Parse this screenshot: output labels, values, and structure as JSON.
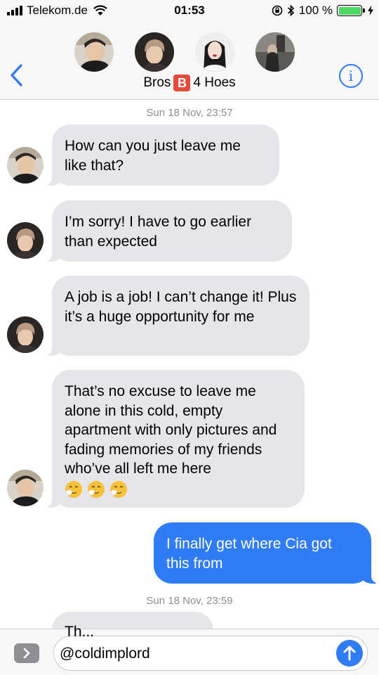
{
  "status_bar": {
    "carrier": "Telekom.de",
    "time": "01:53",
    "battery_percent": "100 %",
    "battery_level": 1.0,
    "icons": [
      "signal-icon",
      "wifi-icon",
      "rotation-lock-icon",
      "bluetooth-icon",
      "battery-icon",
      "charging-icon"
    ]
  },
  "header": {
    "group_name_prefix": "Bros",
    "group_badge": "B",
    "group_name_suffix": "4 Hoes",
    "back_icon": "chevron-left-icon",
    "info_icon": "info-icon",
    "info_glyph": "i",
    "accent_color": "#2f7cf6"
  },
  "conversation": {
    "timestamp_1": "Sun 18 Nov, 23:57",
    "messages": [
      {
        "direction": "incoming",
        "text": "How can you just leave me like that?"
      },
      {
        "direction": "incoming",
        "text": "I’m sorry! I have to go earlier than expected"
      },
      {
        "direction": "incoming",
        "text": "A job is a job! I can’t change it! Plus it’s a huge opportunity for me"
      },
      {
        "direction": "incoming",
        "text": "That’s no excuse to leave me alone in this  cold, empty apartment with only pictures and fading memories of my friends who’ve all left me here",
        "emoji": [
          "sneezing-face-emoji",
          "sneezing-face-emoji",
          "sneezing-face-emoji"
        ]
      },
      {
        "direction": "outgoing",
        "text": "I finally get where Cia got this from"
      }
    ],
    "timestamp_2": "Sun 18 Nov, 23:59",
    "partial_message": "Th...",
    "incoming_color": "#e5e5ea",
    "outgoing_color": "#2f7cf6"
  },
  "input_bar": {
    "value": "@coldimplord",
    "apps_icon": "chevron-right-icon",
    "send_icon": "arrow-up-icon"
  }
}
